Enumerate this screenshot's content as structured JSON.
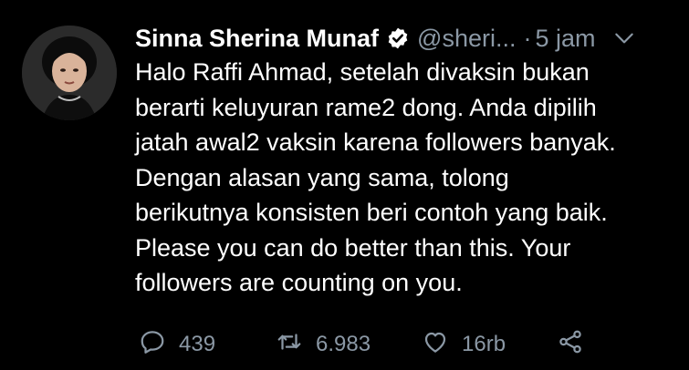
{
  "tweet": {
    "author_name": "Sinna Sherina Munaf",
    "handle": "@sheri...",
    "separator": "·",
    "time": "5 jam",
    "text_lines": [
      "Halo Raffi Ahmad, setelah divaksin bukan",
      "berarti keluyuran rame2 dong. Anda dipilih",
      "jatah awal2 vaksin karena followers banyak.",
      "Dengan alasan yang sama, tolong",
      "berikutnya konsisten beri contoh yang baik.",
      "Please you can do better than this. Your",
      "followers are counting on you."
    ],
    "actions": {
      "replies": "439",
      "retweets": "6.983",
      "likes": "16rb"
    }
  },
  "icons": {
    "verified": "verified-badge-icon",
    "menu": "chevron-down-icon",
    "reply": "reply-icon",
    "retweet": "retweet-icon",
    "like": "heart-icon",
    "share": "share-icon"
  },
  "colors": {
    "background": "#000000",
    "text": "#ffffff",
    "muted": "#8b98a5"
  }
}
